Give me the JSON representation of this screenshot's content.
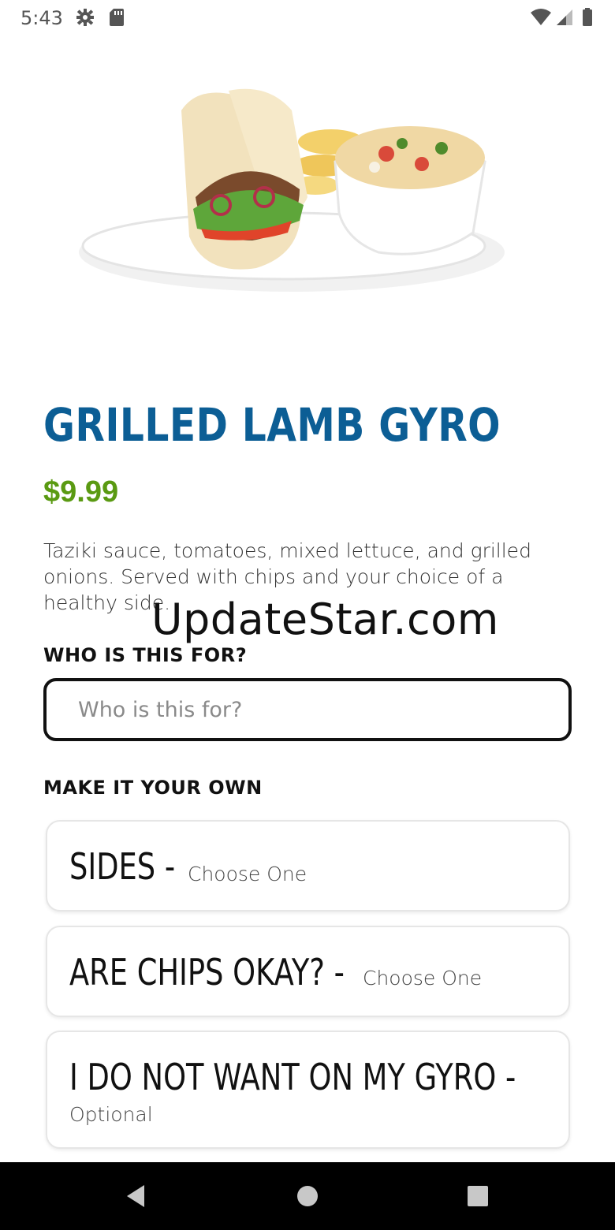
{
  "status": {
    "time": "5:43",
    "icons": [
      "gear-icon",
      "sdcard-icon",
      "wifi-icon",
      "signal-icon",
      "battery-icon"
    ]
  },
  "item": {
    "title": "GRILLED LAMB GYRO",
    "price": "$9.99",
    "description": "Taziki sauce, tomatoes, mixed lettuce, and grilled onions.  Served with chips and your choice of a healthy side."
  },
  "watermark": "UpdateStar.com",
  "who": {
    "label": "WHO IS THIS FOR?",
    "placeholder": "Who is this for?",
    "value": ""
  },
  "options": {
    "label": "MAKE IT YOUR OWN",
    "cards": [
      {
        "title": "SIDES -",
        "subtitle": "Choose One"
      },
      {
        "title": "ARE CHIPS OKAY? -",
        "subtitle": "Choose One"
      },
      {
        "title": "I DO NOT WANT ON MY GYRO -",
        "subtitle": "Optional"
      }
    ]
  },
  "colors": {
    "title": "#0c5e95",
    "price": "#5a9a12",
    "navbar": "#000000"
  },
  "nav": {
    "icons": [
      "back-icon",
      "home-icon",
      "recents-icon"
    ]
  }
}
